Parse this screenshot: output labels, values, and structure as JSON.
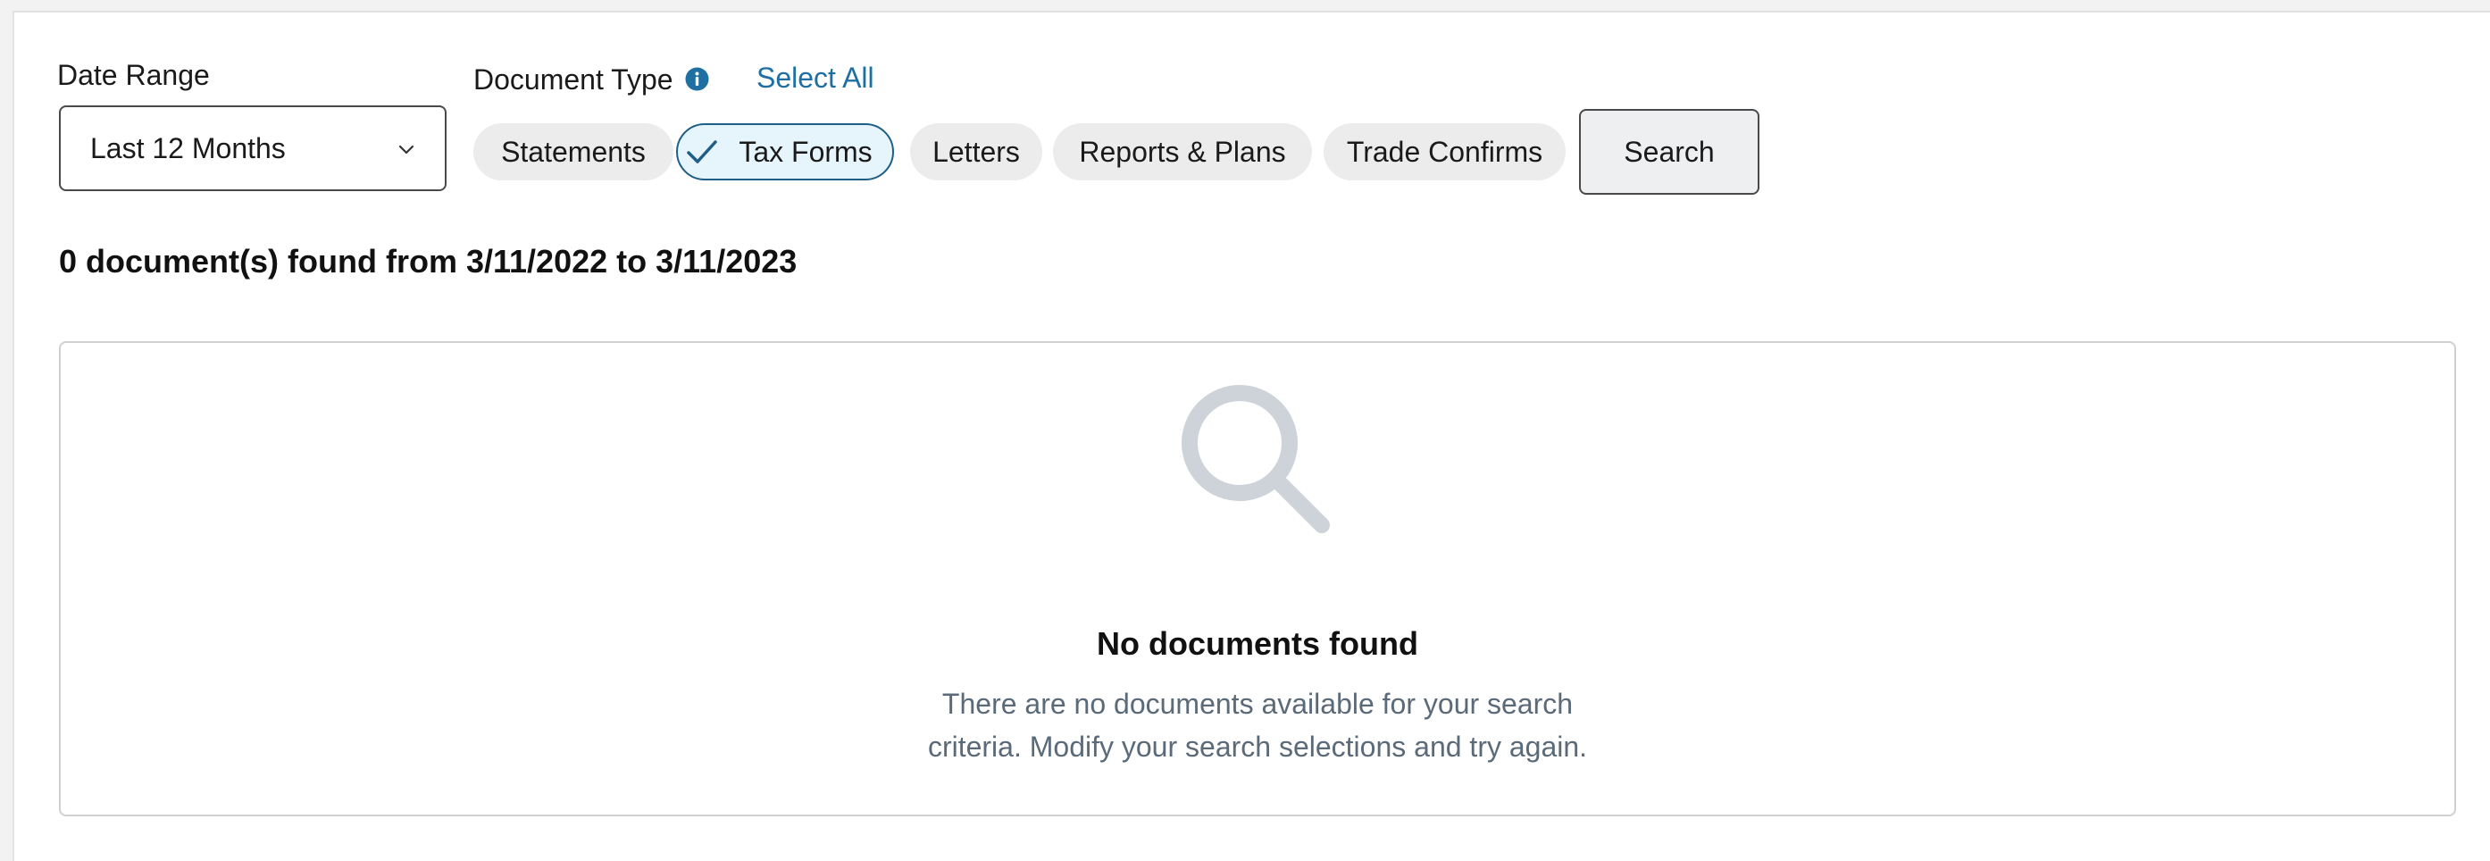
{
  "filters": {
    "date_range_label": "Date Range",
    "date_range_value": "Last 12 Months",
    "document_type_label": "Document Type",
    "select_all_label": "Select All",
    "document_types": [
      {
        "label": "Statements",
        "selected": false
      },
      {
        "label": "Tax Forms",
        "selected": true
      },
      {
        "label": "Letters",
        "selected": false
      },
      {
        "label": "Reports & Plans",
        "selected": false
      },
      {
        "label": "Trade Confirms",
        "selected": false
      }
    ],
    "search_label": "Search"
  },
  "results": {
    "summary": "0 document(s) found from 3/11/2022 to 3/11/2023",
    "empty_title": "No documents found",
    "empty_message": "There are no documents available for your search criteria. Modify your search selections and try again."
  },
  "icons": {
    "info": "info-icon",
    "chevron": "chevron-down-icon",
    "check": "checkmark-icon",
    "empty": "search-icon"
  },
  "colors": {
    "link": "#1f6fa3",
    "selected_chip_bg": "#e6f4fb",
    "selected_chip_border": "#1f5f87",
    "chip_bg": "#ececec",
    "muted_text": "#5b6a78",
    "empty_icon": "#cdd3d9"
  }
}
